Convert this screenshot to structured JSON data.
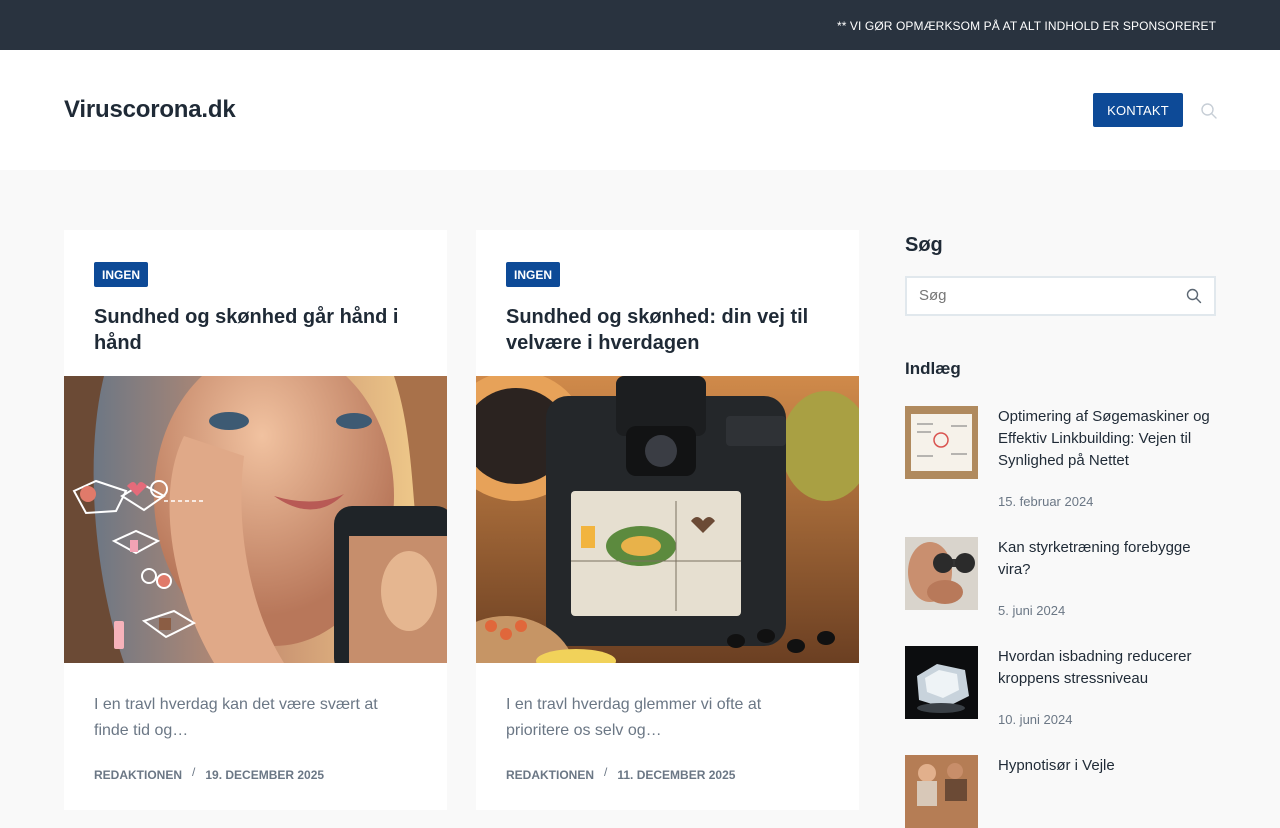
{
  "topbar": {
    "notice": "** VI GØR OPMÆRKSOM PÅ AT ALT INDHOLD ER SPONSORERET"
  },
  "header": {
    "site_title": "Viruscorona.dk",
    "contact_label": "KONTAKT",
    "search_icon": "search-icon"
  },
  "articles": [
    {
      "category": "INGEN",
      "title": "Sundhed og skønhed går hånd i hånd",
      "excerpt": "I en travl hverdag kan det være svært at finde tid og…",
      "author": "REDAKTIONEN",
      "date": "19. DECEMBER 2025"
    },
    {
      "category": "INGEN",
      "title": "Sundhed og skønhed: din vej til velvære i hverdagen",
      "excerpt": "I en travl hverdag glemmer vi ofte at prioritere os selv og…",
      "author": "REDAKTIONEN",
      "date": "11. DECEMBER 2025"
    }
  ],
  "sidebar": {
    "search_title": "Søg",
    "search_placeholder": "Søg",
    "posts_title": "Indlæg",
    "posts": [
      {
        "title": "Optimering af Søgemaskiner og Effektiv Linkbuilding: Vejen til Synlighed på Nettet",
        "date": "15. februar 2024"
      },
      {
        "title": "Kan styrketræning forebygge vira?",
        "date": "5. juni 2024"
      },
      {
        "title": "Hvordan isbadning reducerer kroppens stressniveau",
        "date": "10. juni 2024"
      },
      {
        "title": "Hypnotisør i Vejle",
        "date": ""
      }
    ]
  },
  "colors": {
    "accent": "#0d4a97",
    "topbar": "#29333f",
    "text_dark": "#1f2a36",
    "text_muted": "#6b7785"
  }
}
